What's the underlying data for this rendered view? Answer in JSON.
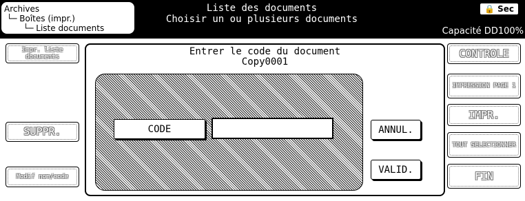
{
  "header": {
    "breadcrumb": [
      "Archives",
      "Boîtes (impr.)",
      "Liste documents"
    ],
    "title_line1": "Liste des documents",
    "title_line2": "Choisir un ou plusieurs documents",
    "security_badge": "Sec",
    "security_icon": "lock-icon",
    "capacity": "Capacité DD100%"
  },
  "left_buttons": [
    {
      "label": "Impr. liste documents",
      "enabled": false
    },
    {
      "label": "SUPPR.",
      "enabled": false
    },
    {
      "label": "Modif nom/code",
      "enabled": false
    }
  ],
  "right_buttons": [
    {
      "label": "CONTROLE",
      "enabled": false
    },
    {
      "label": "IMPRESSION PAGE 1",
      "enabled": false
    },
    {
      "label": "IMPR.",
      "enabled": false
    },
    {
      "label": "TOUT SELECTIONNER",
      "enabled": false
    },
    {
      "label": "FIN",
      "enabled": false
    }
  ],
  "dialog": {
    "title": "Entrer le code du document",
    "document_name": "Copy0001",
    "code_label": "CODE",
    "code_value": "",
    "cancel_label": "ANNUL.",
    "ok_label": "VALID."
  }
}
